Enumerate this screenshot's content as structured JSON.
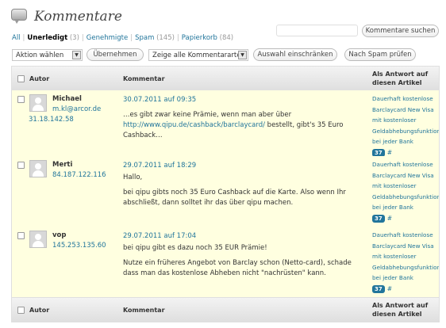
{
  "page": {
    "title": "Kommentare"
  },
  "filters": {
    "all": "All",
    "sep": "|",
    "pending": {
      "label": "Unerledigt",
      "count": "(3)"
    },
    "approved": "Genehmigte",
    "spam": {
      "label": "Spam",
      "count": "(145)"
    },
    "trash": {
      "label": "Papierkorb",
      "count": "(84)"
    }
  },
  "search": {
    "value": "",
    "button": "Kommentare suchen"
  },
  "toolbar": {
    "bulk_action": "Aktion wählen",
    "apply": "Übernehmen",
    "type_filter": "Zeige alle Kommentararten",
    "filter_button": "Auswahl einschränken",
    "spam_check": "Nach Spam prüfen"
  },
  "columns": {
    "author": "Autor",
    "comment": "Kommentar",
    "response_l1": "Als Antwort auf",
    "response_l2": "diesen Artikel"
  },
  "comments": [
    {
      "author": "Michael",
      "email": "m.kl@arcor.de",
      "ip": "31.18.142.58",
      "date": "30.07.2011 auf 09:35",
      "text_pre": "…es gibt zwar keine Prämie, wenn man aber über ",
      "link": "http://www.qipu.de/cashback/barclaycard/",
      "text_post": " bestellt, gibt's 35 Euro Cashback…",
      "response": [
        "Dauerhaft kostenlose",
        "Barclaycard New Visa",
        "mit kostenloser",
        "Geldabhebungsfunktion",
        "bei jeder Bank"
      ],
      "count": "37",
      "hash": "#"
    },
    {
      "author": "Merti",
      "ip": "84.187.122.116",
      "date": "29.07.2011 auf 18:29",
      "p1": "Hallo,",
      "p2": "bei qipu gibts noch 35 Euro Cashback auf die Karte. Also wenn Ihr abschließt, dann solltet ihr das über qipu machen.",
      "response": [
        "Dauerhaft kostenlose",
        "Barclaycard New Visa",
        "mit kostenloser",
        "Geldabhebungsfunktion",
        "bei jeder Bank"
      ],
      "count": "37",
      "hash": "#"
    },
    {
      "author": "vop",
      "ip": "145.253.135.60",
      "date": "29.07.2011 auf 17:04",
      "p1": "bei qipu gibt es dazu noch 35 EUR Prämie!",
      "p2": "Nutze ein früheres Angebot von Barclay schon (Netto-card), schade dass man das kostenlose Abheben nicht \"nachrüsten\" kann.",
      "response": [
        "Dauerhaft kostenlose",
        "Barclaycard New Visa",
        "mit kostenloser",
        "Geldabhebungsfunktion",
        "bei jeder Bank"
      ],
      "count": "37",
      "hash": "#"
    }
  ]
}
